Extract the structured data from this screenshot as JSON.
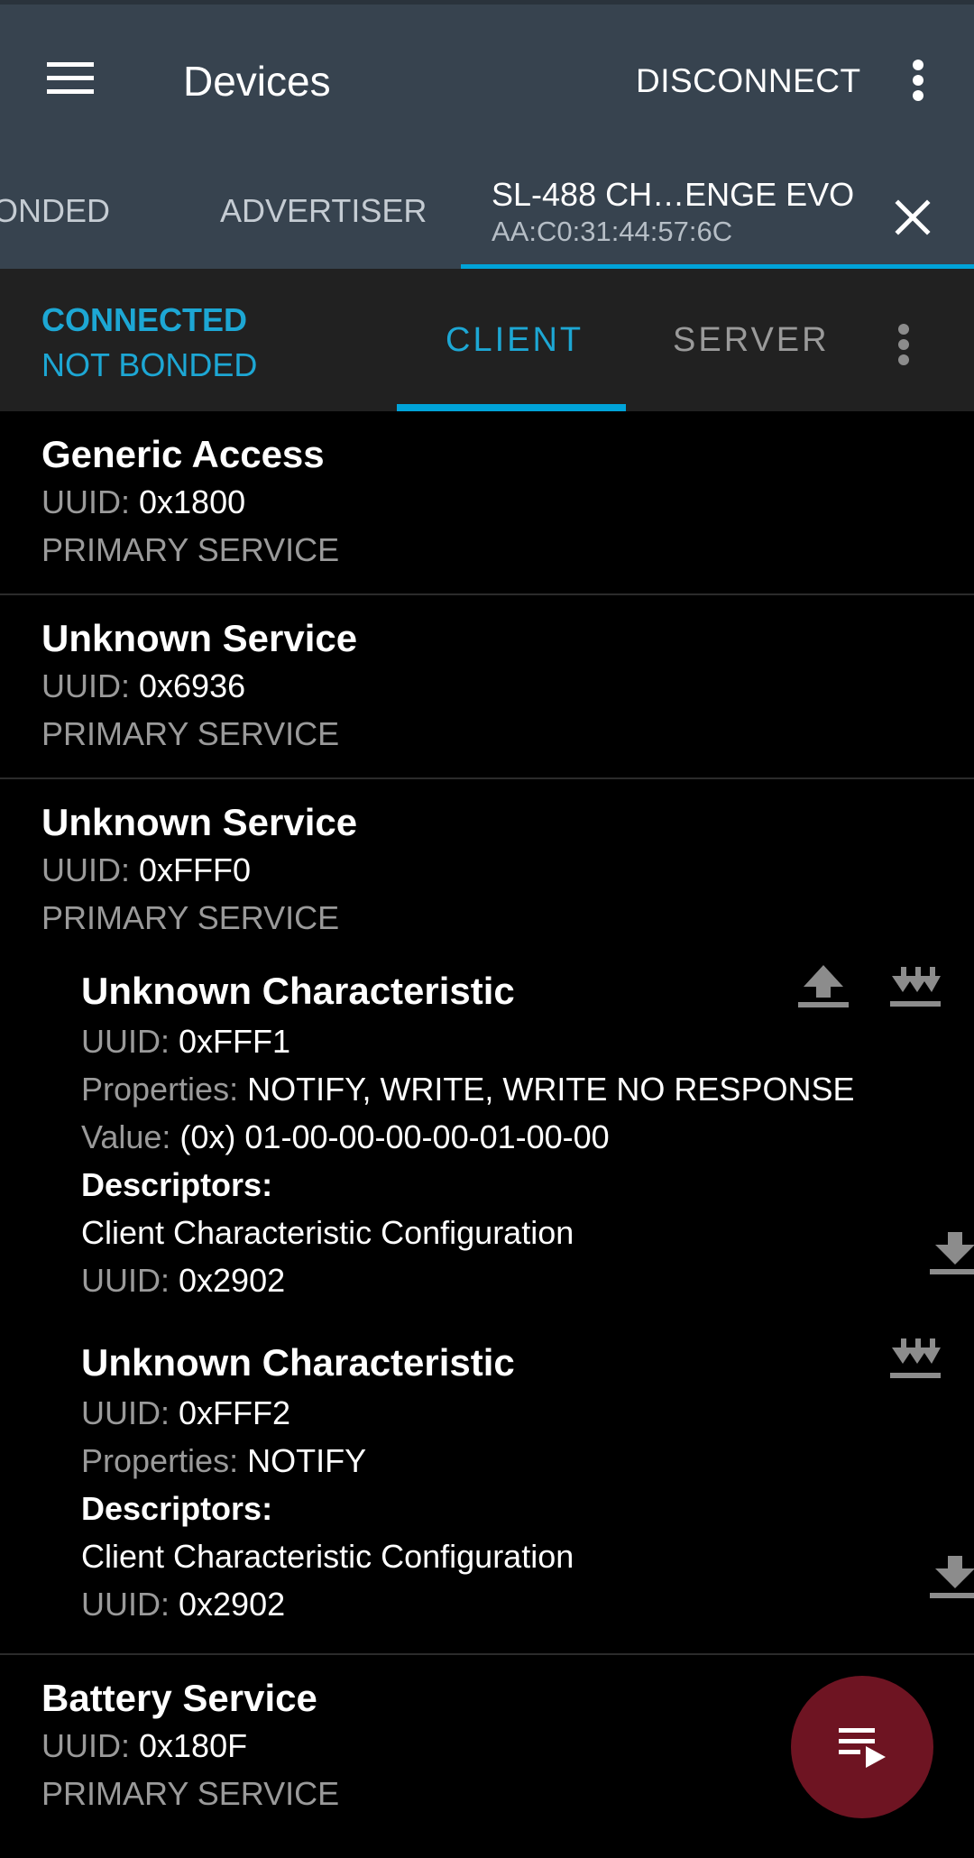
{
  "appbar": {
    "title": "Devices",
    "disconnect_label": "DISCONNECT",
    "background_color": "#37434f"
  },
  "device_tabs": [
    {
      "label": "ONDED"
    },
    {
      "label": "ADVERTISER"
    },
    {
      "label": "SL-488 CH…ENGE EVO",
      "address": "AA:C0:31:44:57:6C",
      "selected": true
    }
  ],
  "status": {
    "connection": "CONNECTED",
    "bond": "NOT BONDED",
    "accent_color": "#1da7d4"
  },
  "client_tabs": [
    {
      "label": "CLIENT",
      "selected": true
    },
    {
      "label": "SERVER",
      "selected": false
    }
  ],
  "labels": {
    "uuid": "UUID:",
    "properties": "Properties:",
    "value": "Value:",
    "descriptors": "Descriptors:"
  },
  "services": [
    {
      "name": "Generic Access",
      "uuid": "0x1800",
      "type": "PRIMARY SERVICE"
    },
    {
      "name": "Unknown Service",
      "uuid": "0x6936",
      "type": "PRIMARY SERVICE"
    },
    {
      "name": "Unknown Service",
      "uuid": "0xFFF0",
      "type": "PRIMARY SERVICE",
      "characteristics": [
        {
          "name": "Unknown Characteristic",
          "uuid": "0xFFF1",
          "properties": "NOTIFY, WRITE, WRITE NO RESPONSE",
          "value": "(0x) 01-00-00-00-00-01-00-00",
          "icons": [
            "upload-icon",
            "notify-icon"
          ],
          "descriptors": [
            {
              "name": "Client Characteristic Configuration",
              "uuid": "0x2902",
              "icon": "download-icon"
            }
          ]
        },
        {
          "name": "Unknown Characteristic",
          "uuid": "0xFFF2",
          "properties": "NOTIFY",
          "icons": [
            "notify-icon"
          ],
          "descriptors": [
            {
              "name": "Client Characteristic Configuration",
              "uuid": "0x2902",
              "icon": "download-icon"
            }
          ]
        }
      ]
    },
    {
      "name": "Battery Service",
      "uuid": "0x180F",
      "type": "PRIMARY SERVICE"
    }
  ],
  "fab": {
    "icon": "queue-play-icon",
    "color": "#6e1422"
  }
}
